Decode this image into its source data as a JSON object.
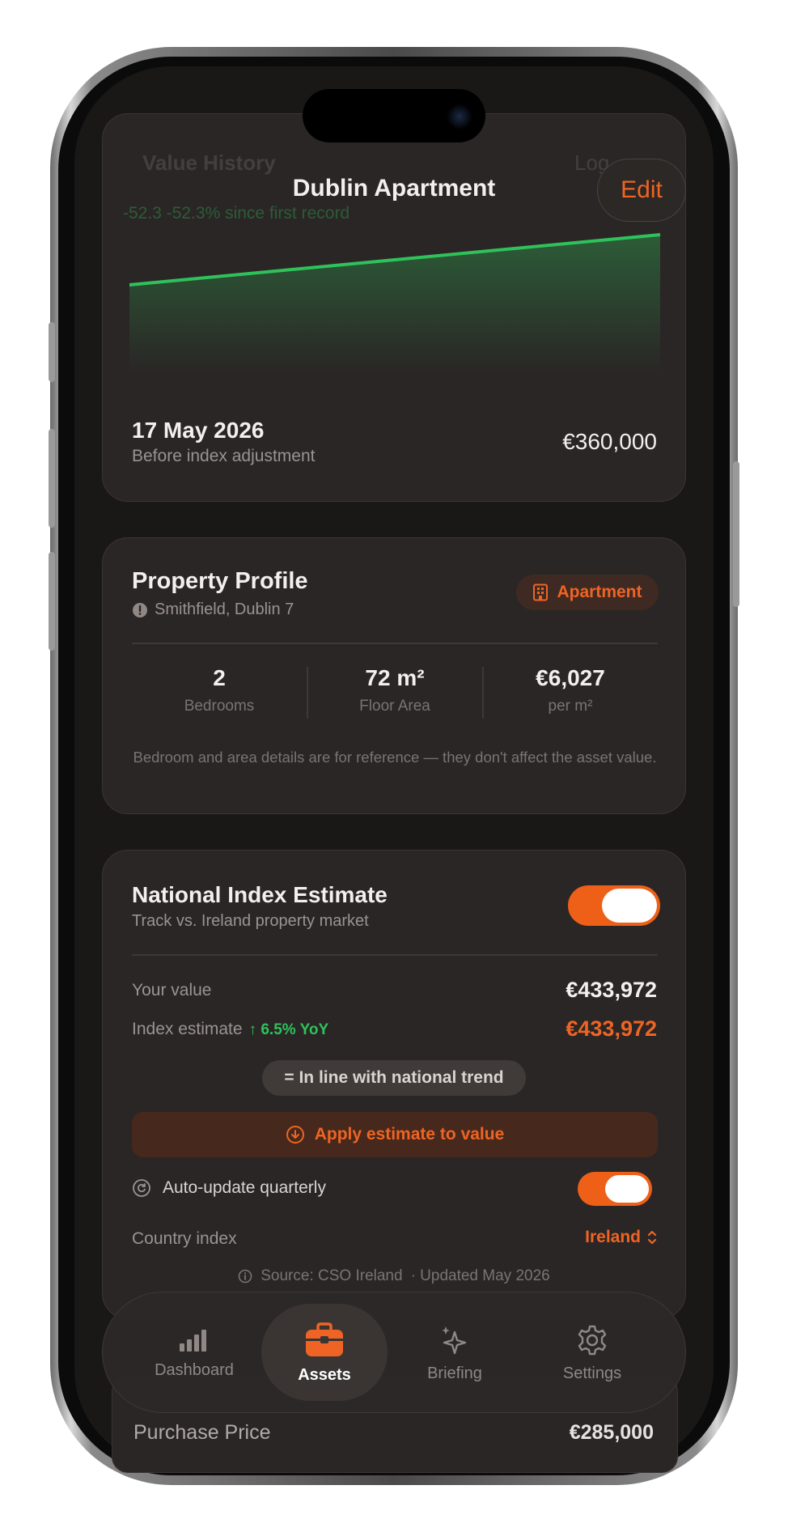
{
  "header": {
    "title": "Dublin Apartment",
    "edit_label": "Edit",
    "ghost_title": "Value History",
    "ghost_right": "Log",
    "ghost_change": "-52.3 -52.3% since first record"
  },
  "history": {
    "date": "17 May 2026",
    "note": "Before index adjustment",
    "value": "€360,000",
    "line_color": "#2fc25b"
  },
  "profile": {
    "title": "Property Profile",
    "location": "Smithfield, Dublin 7",
    "type_badge": "Apartment",
    "stats": [
      {
        "value": "2",
        "label": "Bedrooms"
      },
      {
        "value": "72 m²",
        "label": "Floor Area"
      },
      {
        "value": "€6,027",
        "label": "per m²"
      }
    ],
    "footnote": "Bedroom and area details are for reference — they don't affect the asset value."
  },
  "index": {
    "title": "National Index Estimate",
    "subtitle": "Track vs. Ireland property market",
    "enabled": true,
    "your_value_label": "Your value",
    "your_value": "€433,972",
    "estimate_label": "Index estimate",
    "yoy": "↑ 6.5% YoY",
    "estimate_value": "€433,972",
    "trend_badge": "= In line with national trend",
    "apply_label": "Apply estimate to value",
    "auto_update_label": "Auto-update quarterly",
    "auto_update_enabled": true,
    "country_label": "Country index",
    "country_value": "Ireland",
    "source": "Source: CSO Ireland",
    "updated": "· Updated May 2026"
  },
  "purchase": {
    "label": "Purchase Price",
    "value": "€285,000"
  },
  "tabs": [
    {
      "label": "Dashboard",
      "icon": "bar-chart-icon",
      "active": false
    },
    {
      "label": "Assets",
      "icon": "briefcase-icon",
      "active": true
    },
    {
      "label": "Briefing",
      "icon": "sparkle-icon",
      "active": false
    },
    {
      "label": "Settings",
      "icon": "gear-icon",
      "active": false
    }
  ],
  "colors": {
    "accent": "#ef6424",
    "positive": "#2fc25b",
    "background": "#1a1817",
    "card": "#2a2625"
  }
}
